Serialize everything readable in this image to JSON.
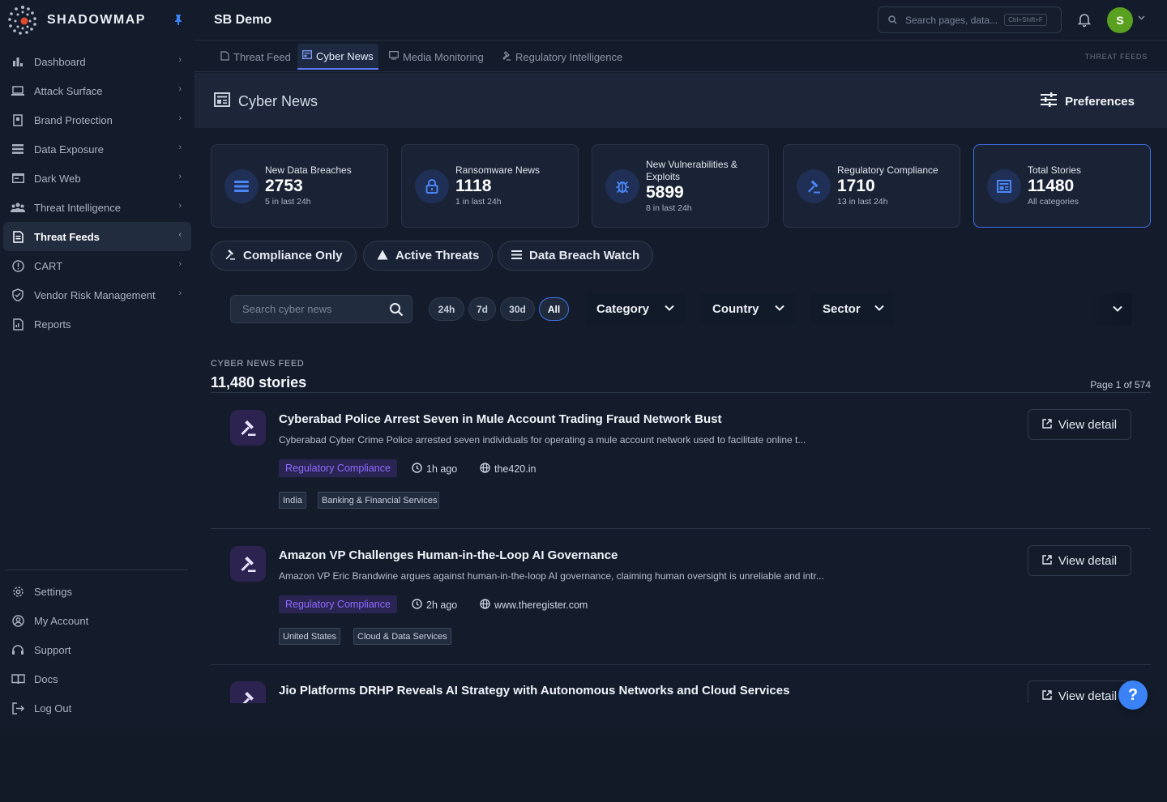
{
  "brand": {
    "name": "SHADOWMAP"
  },
  "colors": {
    "accent": "#3b82f6",
    "category": "#8e6bff",
    "avatar": "#5aa020"
  },
  "sidebar": {
    "items": [
      {
        "label": "Dashboard",
        "icon": "bar-chart-icon",
        "has_chevron": true
      },
      {
        "label": "Attack Surface",
        "icon": "laptop-icon",
        "has_chevron": true
      },
      {
        "label": "Brand Protection",
        "icon": "badge-icon",
        "has_chevron": true
      },
      {
        "label": "Data Exposure",
        "icon": "list-icon",
        "has_chevron": true
      },
      {
        "label": "Dark Web",
        "icon": "window-icon",
        "has_chevron": true
      },
      {
        "label": "Threat Intelligence",
        "icon": "group-icon",
        "has_chevron": true
      },
      {
        "label": "Threat Feeds",
        "icon": "document-icon",
        "has_chevron": true,
        "active": true
      },
      {
        "label": "CART",
        "icon": "info-circle-icon",
        "has_chevron": true
      },
      {
        "label": "Vendor Risk Management",
        "icon": "shield-check-icon",
        "has_chevron": true
      },
      {
        "label": "Reports",
        "icon": "report-icon",
        "has_chevron": false
      }
    ],
    "bottom": [
      {
        "label": "Settings",
        "icon": "gear-icon"
      },
      {
        "label": "My Account",
        "icon": "account-icon"
      },
      {
        "label": "Support",
        "icon": "support-icon"
      },
      {
        "label": "Docs",
        "icon": "book-icon"
      },
      {
        "label": "Log Out",
        "icon": "logout-icon"
      }
    ]
  },
  "header": {
    "org_name": "SB Demo",
    "search_placeholder": "Search pages, data...",
    "search_shortcut": "Ctrl+Shift+F",
    "avatar_initial": "S"
  },
  "tabs": {
    "items": [
      {
        "label": "Threat Feed",
        "icon": "document-icon"
      },
      {
        "label": "Cyber News",
        "icon": "newspaper-icon",
        "active": true
      },
      {
        "label": "Media Monitoring",
        "icon": "monitor-icon"
      },
      {
        "label": "Regulatory Intelligence",
        "icon": "gavel-icon"
      }
    ],
    "section_label": "THREAT FEEDS"
  },
  "page": {
    "title": "Cyber News",
    "preferences_label": "Preferences"
  },
  "stats": [
    {
      "label": "New Data Breaches",
      "value": "2753",
      "sub": "5 in last 24h",
      "icon": "list-icon"
    },
    {
      "label": "Ransomware News",
      "value": "1118",
      "sub": "1 in last 24h",
      "icon": "lock-icon"
    },
    {
      "label": "New Vulnerabilities & Exploits",
      "value": "5899",
      "sub": "8 in last 24h",
      "icon": "bug-icon"
    },
    {
      "label": "Regulatory Compliance",
      "value": "1710",
      "sub": "13 in last 24h",
      "icon": "gavel-icon"
    },
    {
      "label": "Total Stories",
      "value": "11480",
      "sub": "All categories",
      "icon": "newspaper-icon",
      "selected": true
    }
  ],
  "quick_filters": [
    {
      "label": "Compliance Only",
      "icon": "gavel-icon"
    },
    {
      "label": "Active Threats",
      "icon": "warning-icon"
    },
    {
      "label": "Data Breach Watch",
      "icon": "list-icon"
    }
  ],
  "filters": {
    "search_placeholder": "Search cyber news",
    "ranges": [
      "24h",
      "7d",
      "30d",
      "All"
    ],
    "active_range": "All",
    "category_label": "Category",
    "country_label": "Country",
    "sector_label": "Sector"
  },
  "feed": {
    "kicker": "CYBER NEWS FEED",
    "count": "11,480 stories",
    "page": "Page 1 of 574",
    "view_label": "View detail",
    "stories": [
      {
        "title": "Cyberabad Police Arrest Seven in Mule Account Trading Fraud Network Bust",
        "summary": "Cyberabad Cyber Crime Police arrested seven individuals for operating a mule account network used to facilitate online t...",
        "category": "Regulatory Compliance",
        "time": "1h ago",
        "source": "the420.in",
        "tags": [
          "India",
          "Banking & Financial Services"
        ]
      },
      {
        "title": "Amazon VP Challenges Human-in-the-Loop AI Governance",
        "summary": "Amazon VP Eric Brandwine argues against human-in-the-loop AI governance, claiming human oversight is unreliable and intr...",
        "category": "Regulatory Compliance",
        "time": "2h ago",
        "source": "www.theregister.com",
        "tags": [
          "United States",
          "Cloud & Data Services"
        ]
      },
      {
        "title": "Jio Platforms DRHP Reveals AI Strategy with Autonomous Networks and Cloud Services",
        "summary": "",
        "category": "",
        "time": "",
        "source": "",
        "tags": []
      }
    ]
  }
}
